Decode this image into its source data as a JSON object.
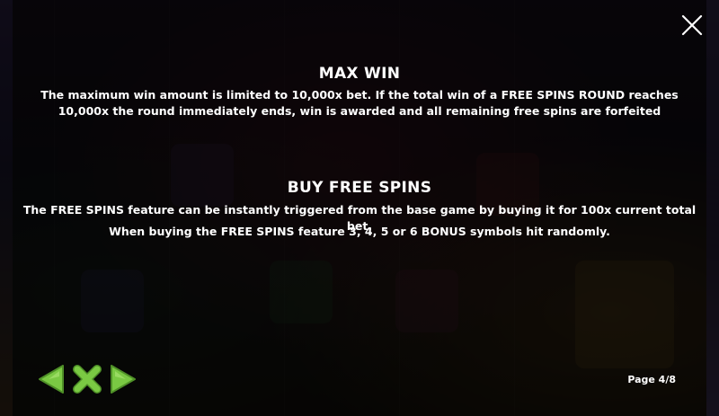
{
  "overlay": {
    "close_icon": "close-icon",
    "page_indicator": "Page 4/8"
  },
  "sections": [
    {
      "title": "MAX WIN",
      "paragraphs": [
        "The maximum win amount is limited to 10,000x bet. If the total win of a FREE SPINS ROUND reaches 10,000x the round immediately ends, win is awarded and all remaining free spins are forfeited"
      ]
    },
    {
      "title": "BUY FREE SPINS",
      "paragraphs": [
        "The FREE SPINS feature can be instantly triggered from the base game by buying it for 100x current total bet.",
        "When buying the FREE SPINS feature 3, 4, 5 or 6 BONUS symbols hit randomly."
      ]
    }
  ],
  "navigation": {
    "prev_icon": "arrow-left-icon",
    "close_icon": "x-close-icon",
    "next_icon": "arrow-right-icon",
    "accent_color": "#7ac943"
  }
}
